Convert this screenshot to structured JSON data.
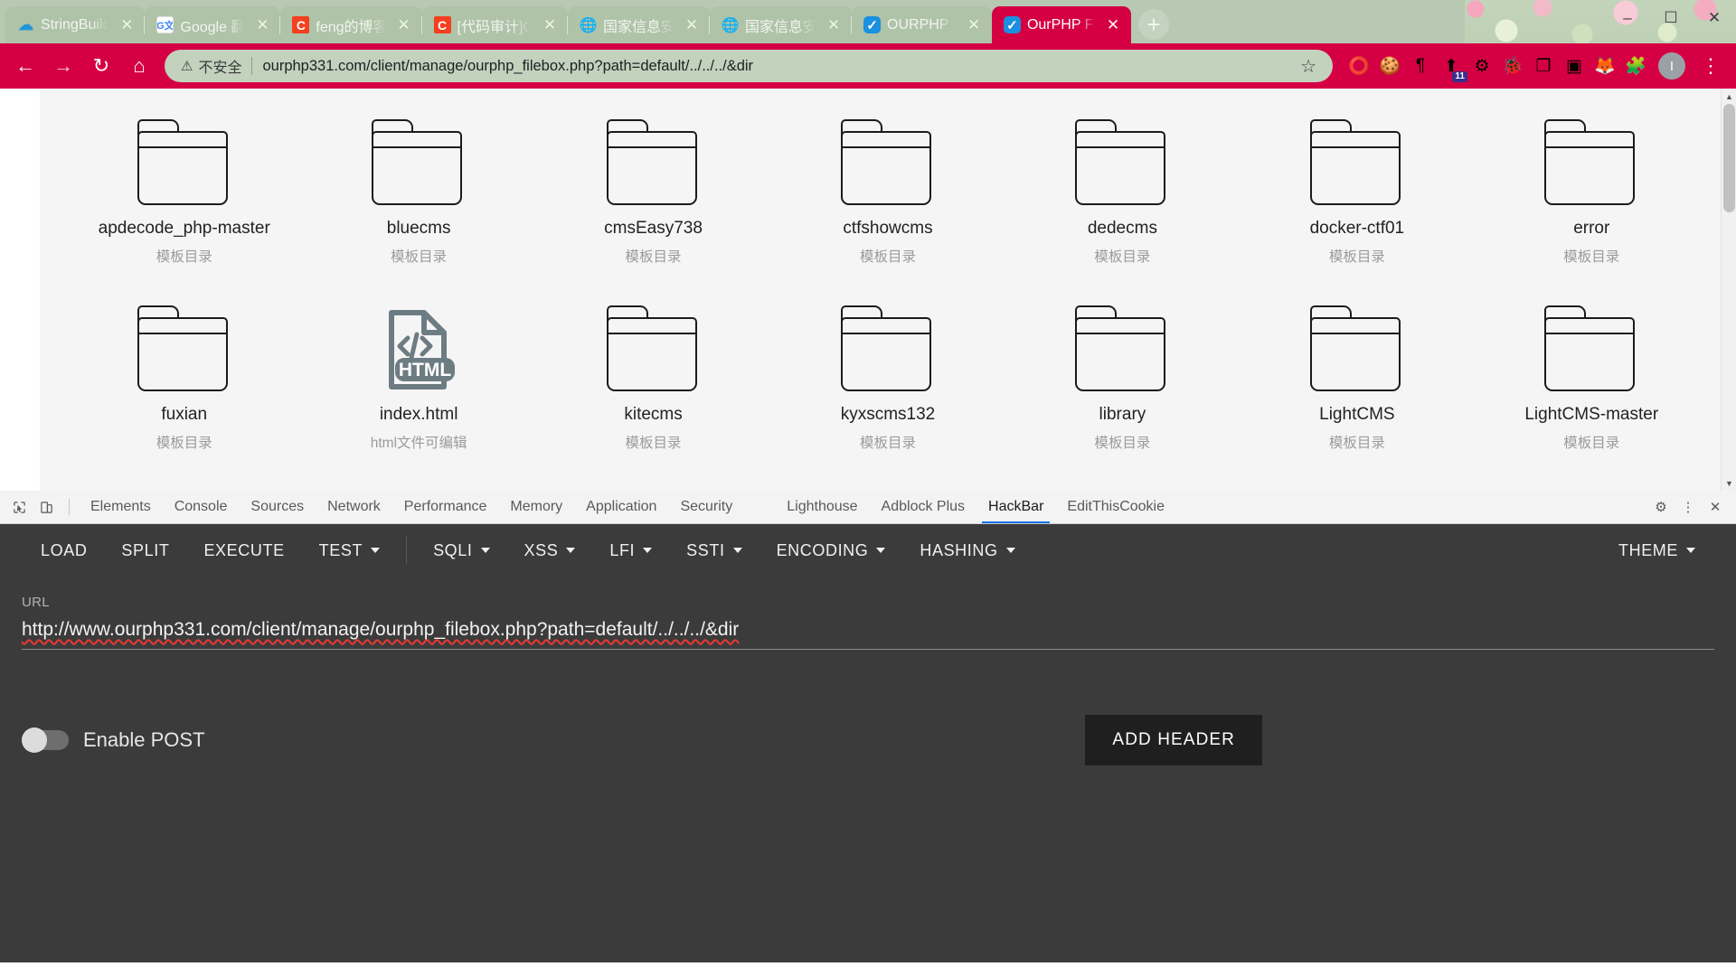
{
  "window": {
    "controls": [
      {
        "name": "minimize",
        "glyph": "–"
      },
      {
        "name": "maximize",
        "glyph": "☐"
      },
      {
        "name": "close",
        "glyph": "✕"
      }
    ]
  },
  "tabs": [
    {
      "title": "StringBuild",
      "favicon": "cloud-icon",
      "fav_class": "fav-cloud",
      "fav_glyph": "☁",
      "active": false
    },
    {
      "title": "Google 翻",
      "favicon": "google-translate-icon",
      "fav_class": "fav-g",
      "fav_glyph": "G文",
      "active": false
    },
    {
      "title": "feng的博客",
      "favicon": "csdn-icon",
      "fav_class": "fav-c",
      "fav_glyph": "C",
      "active": false
    },
    {
      "title": "[代码审计]C",
      "favicon": "csdn-icon",
      "fav_class": "fav-c",
      "fav_glyph": "C",
      "active": false
    },
    {
      "title": "国家信息安",
      "favicon": "globe-icon",
      "fav_class": "fav-globe",
      "fav_glyph": "🌐",
      "active": false
    },
    {
      "title": "国家信息安",
      "favicon": "globe-icon",
      "fav_class": "fav-globe",
      "fav_glyph": "🌐",
      "active": false
    },
    {
      "title": "OURPHP - ",
      "favicon": "ourphp-icon",
      "fav_class": "fav-o",
      "fav_glyph": "✓",
      "active": false
    },
    {
      "title": "OurPHP Fi",
      "favicon": "ourphp-icon",
      "fav_class": "fav-o",
      "fav_glyph": "✓",
      "active": true
    }
  ],
  "newtab_label": "+",
  "toolbar": {
    "back": "←",
    "forward": "→",
    "reload": "↻",
    "home": "⌂",
    "security_icon": "warning-triangle-icon",
    "security_text": "不安全",
    "url": "ourphp331.com/client/manage/ourphp_filebox.php?path=default/../../../&dir",
    "bookmark_star": "☆",
    "extensions": [
      {
        "name": "circle-ring-icon",
        "glyph": "⭕",
        "badge": ""
      },
      {
        "name": "cookie-icon",
        "glyph": "🍪",
        "badge": ""
      },
      {
        "name": "paragraph-arrow-icon",
        "glyph": "¶",
        "badge": ""
      },
      {
        "name": "upload-box-icon",
        "glyph": "⬆",
        "badge": "11"
      },
      {
        "name": "gear-bug-icon",
        "glyph": "⚙",
        "badge": ""
      },
      {
        "name": "bug-icon",
        "glyph": "🐞",
        "badge": ""
      },
      {
        "name": "clipboard-icon",
        "glyph": "❐",
        "badge": ""
      },
      {
        "name": "video-icon",
        "glyph": "▣",
        "badge": ""
      },
      {
        "name": "fox-icon",
        "glyph": "🦊",
        "badge": ""
      },
      {
        "name": "puzzle-icon",
        "glyph": "🧩",
        "badge": ""
      }
    ],
    "avatar_letter": "I",
    "menu_glyph": "⋮"
  },
  "page": {
    "files": [
      {
        "name": "apdecode_php-master",
        "sub": "模板目录",
        "type": "folder"
      },
      {
        "name": "bluecms",
        "sub": "模板目录",
        "type": "folder"
      },
      {
        "name": "cmsEasy738",
        "sub": "模板目录",
        "type": "folder"
      },
      {
        "name": "ctfshowcms",
        "sub": "模板目录",
        "type": "folder"
      },
      {
        "name": "dedecms",
        "sub": "模板目录",
        "type": "folder"
      },
      {
        "name": "docker-ctf01",
        "sub": "模板目录",
        "type": "folder"
      },
      {
        "name": "error",
        "sub": "模板目录",
        "type": "folder"
      },
      {
        "name": "fuxian",
        "sub": "模板目录",
        "type": "folder"
      },
      {
        "name": "index.html",
        "sub": "html文件可编辑",
        "type": "html",
        "badge": "HTML"
      },
      {
        "name": "kitecms",
        "sub": "模板目录",
        "type": "folder"
      },
      {
        "name": "kyxscms132",
        "sub": "模板目录",
        "type": "folder"
      },
      {
        "name": "library",
        "sub": "模板目录",
        "type": "folder"
      },
      {
        "name": "LightCMS",
        "sub": "模板目录",
        "type": "folder"
      },
      {
        "name": "LightCMS-master",
        "sub": "模板目录",
        "type": "folder"
      }
    ],
    "scroll_up": "▲",
    "scroll_down": "▼"
  },
  "devtools": {
    "inspect_icon": "inspect-cursor-icon",
    "device_icon": "device-toolbar-icon",
    "tabs": [
      {
        "label": "Elements",
        "active": false
      },
      {
        "label": "Console",
        "active": false
      },
      {
        "label": "Sources",
        "active": false
      },
      {
        "label": "Network",
        "active": false
      },
      {
        "label": "Performance",
        "active": false
      },
      {
        "label": "Memory",
        "active": false
      },
      {
        "label": "Application",
        "active": false
      },
      {
        "label": "Security",
        "active": false
      },
      {
        "label": "Lighthouse",
        "active": false
      },
      {
        "label": "Adblock Plus",
        "active": false
      },
      {
        "label": "HackBar",
        "active": true
      },
      {
        "label": "EditThisCookie",
        "active": false
      }
    ],
    "settings_glyph": "⚙",
    "more_glyph": "⋮",
    "close_glyph": "✕"
  },
  "hackbar": {
    "buttons": [
      {
        "label": "LOAD",
        "caret": false
      },
      {
        "label": "SPLIT",
        "caret": false
      },
      {
        "label": "EXECUTE",
        "caret": false
      },
      {
        "label": "TEST",
        "caret": true
      },
      {
        "label": "SQLI",
        "caret": true
      },
      {
        "label": "XSS",
        "caret": true
      },
      {
        "label": "LFI",
        "caret": true
      },
      {
        "label": "SSTI",
        "caret": true
      },
      {
        "label": "ENCODING",
        "caret": true
      },
      {
        "label": "HASHING",
        "caret": true
      }
    ],
    "theme_label": "THEME",
    "url_label": "URL",
    "url_value": "http://www.ourphp331.com/client/manage/ourphp_filebox.php?path=default/../../../&dir",
    "enable_post_label": "Enable POST",
    "add_header_label": "ADD HEADER"
  },
  "colors": {
    "brand_crimson": "#d50044",
    "tabstrip_green": "#b7c9b2",
    "devtools_accent": "#1a73e8",
    "hackbar_bg": "#3b3b3b"
  }
}
